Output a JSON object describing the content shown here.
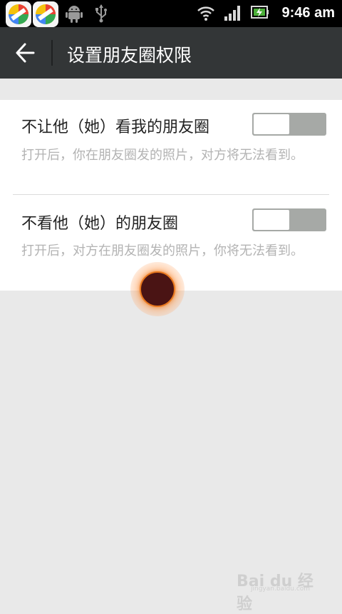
{
  "status_bar": {
    "time": "9:46 am",
    "icons": [
      "app-icon",
      "app-icon",
      "android-icon",
      "usb-icon",
      "wifi-icon",
      "signal-icon",
      "battery-icon"
    ]
  },
  "action_bar": {
    "back_icon": "arrow-left-icon",
    "title": "设置朋友圈权限"
  },
  "settings": [
    {
      "title": "不让他（她）看我的朋友圈",
      "description": "打开后，你在朋友圈发的照片，对方将无法看到。",
      "enabled": false
    },
    {
      "title": "不看他（她）的朋友圈",
      "description": "打开后，对方在朋友圈发的照片，你将无法看到。",
      "enabled": false
    }
  ],
  "colors": {
    "action_bar": "#333637",
    "toggle_off": "#a6a9a6",
    "background": "#e9e9e9",
    "description": "#b3b3b3"
  },
  "watermark": {
    "text": "Bai du 经验",
    "sub": "jingyan.baidu.com"
  }
}
